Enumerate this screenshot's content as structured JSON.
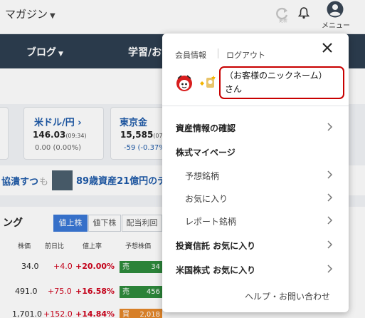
{
  "header": {
    "brand": "マガジン",
    "refresh_caption": "更新",
    "menu_label": "メニュー"
  },
  "nav": {
    "items": [
      "ブログ",
      "学習/お"
    ]
  },
  "cards": [
    {
      "title": "米ドル/円",
      "value": "146.03",
      "time": "(09:34)",
      "change": "0.00 (0.00%)",
      "change_color": "#666666"
    },
    {
      "title": "東京金",
      "value": "15,585",
      "time": "(07",
      "change": "-59 (-0.37%",
      "change_color": "#1e5aa8"
    }
  ],
  "news": {
    "text1": "協潰すつ",
    "text2": "も",
    "text3": "89歳資産21億円のデ"
  },
  "ranking": {
    "title": "ング",
    "tabs": [
      "値上株",
      "値下株",
      "配当利回"
    ],
    "headers": [
      "株価",
      "前日比",
      "値上率",
      "予想株価"
    ],
    "rows": [
      {
        "price": "34.0",
        "diff": "+4.0",
        "rate": "+20.00%",
        "signal": "売",
        "forecast": "34",
        "signal_color": "#2e8b3c"
      },
      {
        "price": "491.0",
        "diff": "+75.0",
        "rate": "+16.58%",
        "signal": "売",
        "forecast": "456",
        "signal_color": "#2e8b3c"
      },
      {
        "price": "1,701.0",
        "diff": "+152.0",
        "rate": "+14.84%",
        "signal": "買",
        "forecast": "2,018",
        "signal_color": "#e5872a"
      }
    ]
  },
  "panel": {
    "member_info": "会員情報",
    "logout": "ログアウト",
    "nickname_line1": "（お客様のニックネーム）",
    "nickname_line2": "さん",
    "menu": [
      {
        "label": "資産情報の確認",
        "bold": true,
        "chevron": true
      },
      {
        "label": "株式マイページ",
        "bold": true,
        "chevron": false
      },
      {
        "label": "予想銘柄",
        "bold": false,
        "chevron": true
      },
      {
        "label": "お気に入り",
        "bold": false,
        "chevron": true
      },
      {
        "label": "レポート銘柄",
        "bold": false,
        "chevron": true
      },
      {
        "label": "投資信託 お気に入り",
        "bold": true,
        "chevron": true
      },
      {
        "label": "米国株式 お気に入り",
        "bold": true,
        "chevron": true
      }
    ],
    "help": "ヘルプ・お問い合わせ"
  },
  "colors": {
    "nav_bg": "#2d3e50",
    "accent": "#3a78d6",
    "link": "#1e5aa8",
    "up": "#d0021b",
    "highlight_border": "#c80000"
  },
  "icons": [
    "refresh-icon",
    "bell-icon",
    "user-icon",
    "close-icon",
    "avatar-icon",
    "badge-icon",
    "chevron-right-icon"
  ]
}
